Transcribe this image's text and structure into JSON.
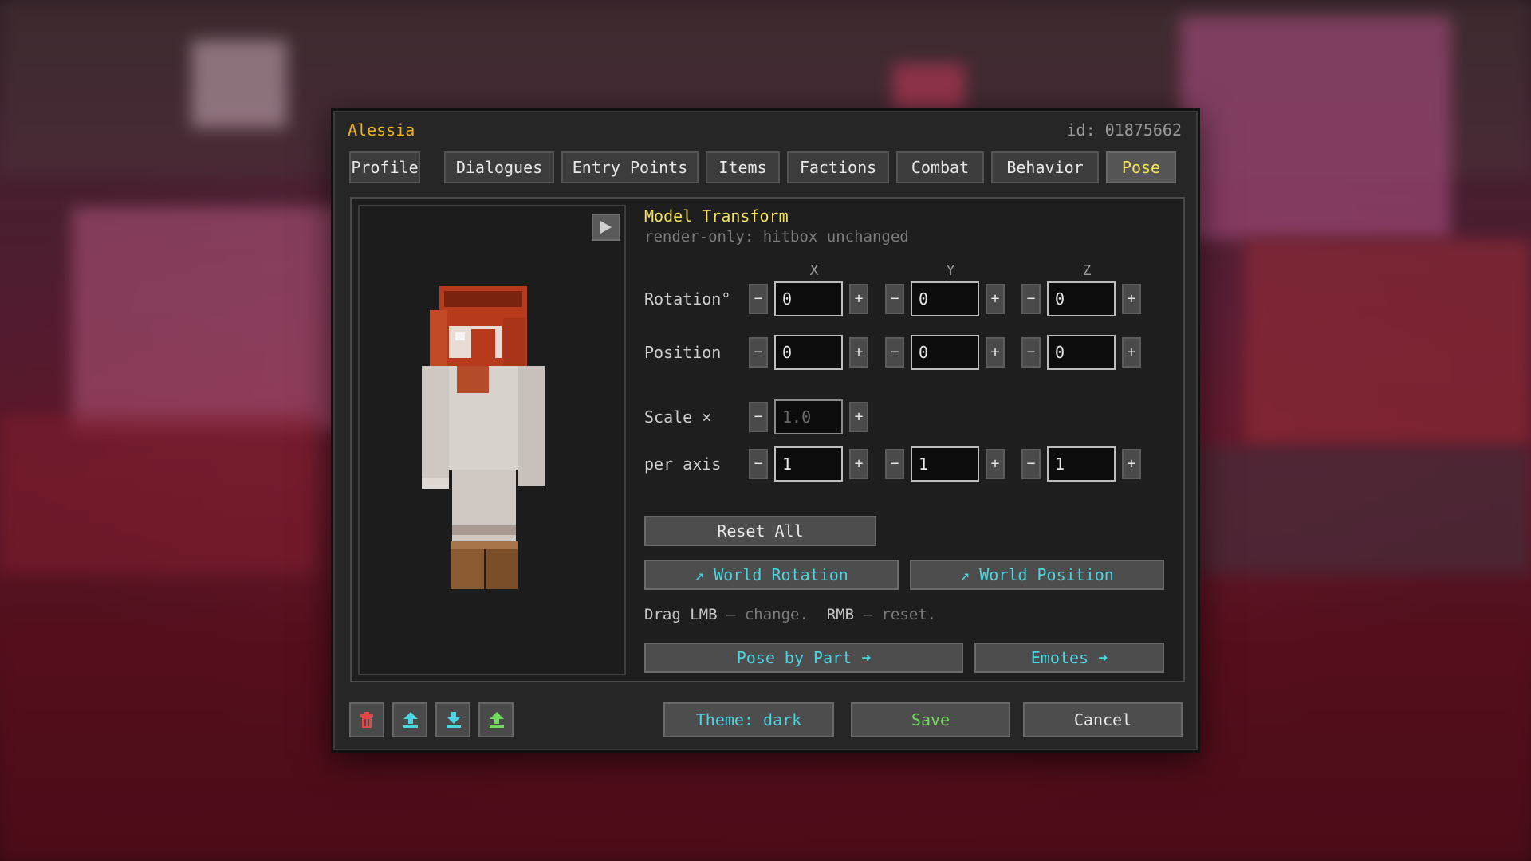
{
  "dialog": {
    "title": "Alessia",
    "id_text": "id: 01875662",
    "tabs": [
      "Profile",
      "Dialogues",
      "Entry Points",
      "Items",
      "Factions",
      "Combat",
      "Behavior",
      "Pose"
    ],
    "active_tab": "Pose"
  },
  "transform": {
    "title": "Model Transform",
    "subtitle": "render-only: hitbox unchanged",
    "axes": [
      "X",
      "Y",
      "Z"
    ],
    "rotation": {
      "label": "Rotation°",
      "values": [
        "0",
        "0",
        "0"
      ]
    },
    "position": {
      "label": "Position",
      "values": [
        "0",
        "0",
        "0"
      ]
    },
    "scale": {
      "label": "Scale ×",
      "value": "1.0"
    },
    "per_axis": {
      "label": "per axis",
      "values": [
        "1",
        "1",
        "1"
      ]
    },
    "minus": "−",
    "plus": "+"
  },
  "buttons": {
    "reset_all": "Reset All",
    "world_rotation": "↗ World Rotation",
    "world_position": "↗ World Position",
    "pose_by_part": "Pose by Part ➜",
    "emotes": "Emotes ➜",
    "theme": "Theme: dark",
    "save": "Save",
    "cancel": "Cancel"
  },
  "hint": {
    "k1": "Drag LMB",
    "t1": " — change.  ",
    "k2": "RMB",
    "t2": " — reset."
  },
  "icons": {
    "play": "play-icon",
    "delete": "trash-icon",
    "upload": "upload-icon",
    "download": "download-icon",
    "export": "export-icon"
  },
  "colors": {
    "title": "#f0b21e",
    "active_tab": "#f5e35a",
    "cyan": "#49d6e0",
    "green": "#6edc5a",
    "delete": "#e04848"
  }
}
